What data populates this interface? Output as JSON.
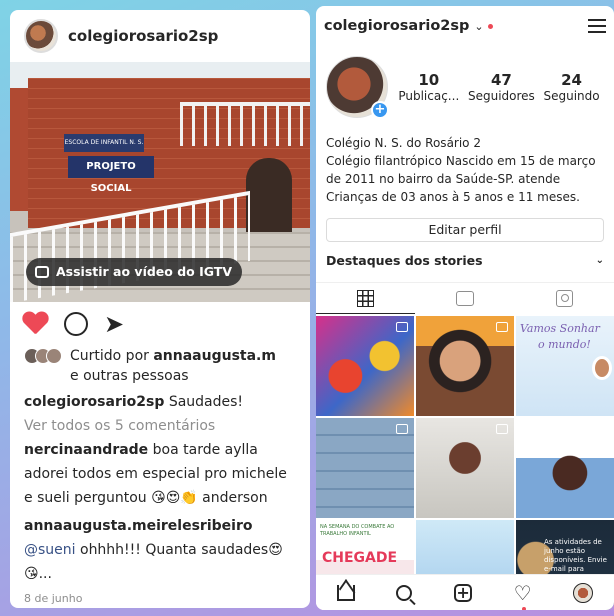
{
  "post": {
    "username": "colegiorosario2sp",
    "building_sign_small": "ESCOLA DE INFANTIL N. S. DO ROSÁRIO",
    "building_sign": "PROJETO SOCIAL",
    "igtv_label": "Assistir ao vídeo do IGTV",
    "liked_by_prefix": "Curtido por ",
    "liked_by_user": "annaaugusta.m",
    "liked_by_suffix": "e outras pessoas",
    "caption_user": "colegiorosario2sp",
    "caption_text": " Saudades!",
    "view_comments": "Ver todos os 5 comentários",
    "comments": [
      {
        "user": "nercinaandrade",
        "text": " boa tarde aylla adorei todos em especial pro michele e sueli perguntou 😘😍👏 anderson"
      },
      {
        "user": "annaaugusta.meirelesribeiro",
        "mention": " @sueni",
        "text": " ohhhh!!! Quanta saudades😍😘..."
      }
    ],
    "date": "8 de junho"
  },
  "profile": {
    "username": "colegiorosario2sp",
    "stats": [
      {
        "number": "10",
        "label": "Publicaç..."
      },
      {
        "number": "47",
        "label": "Seguidores"
      },
      {
        "number": "24",
        "label": "Seguindo"
      }
    ],
    "bio_name": "Colégio N. S. do Rosário 2",
    "bio_text": "Colégio filantrópico Nascido em 15 de março de 2011 no bairro da Saúde-SP. atende Crianças de 03 anos à 5 anos e 11 meses.",
    "edit_profile": "Editar perfil",
    "highlights": "Destaques dos stories",
    "grid": {
      "tile3_line1": "Vamos Sonhar",
      "tile3_line2": "o mundo!",
      "tile7_small": "NA SEMANA DO COMBATE AO TRABALHO INFANTIL",
      "tile7_title": "CHEGADE",
      "tile9_text": "As atividades de junho estão disponíveis. Envie e-mail para"
    }
  },
  "icons": {
    "heart_filled": "heart-icon",
    "comment": "comment-icon",
    "share": "share-icon",
    "igtv": "igtv-icon"
  },
  "colors": {
    "like": "#ed4956",
    "link": "#385185",
    "accent": "#3897f0"
  }
}
